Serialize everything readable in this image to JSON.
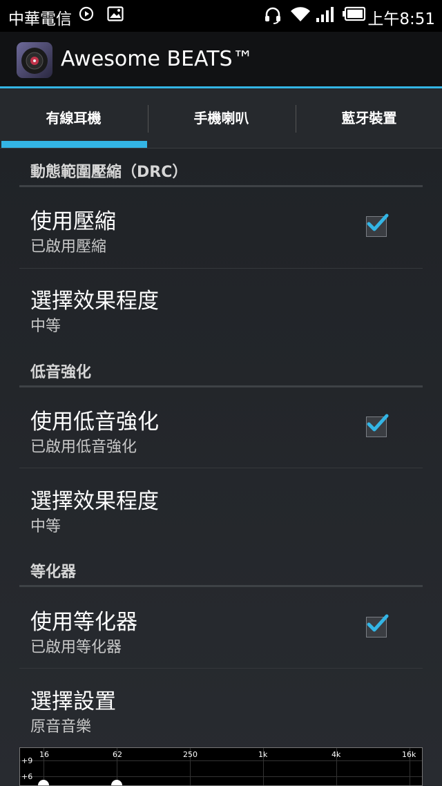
{
  "status_bar": {
    "carrier": "中華電信",
    "time": "上午8:51",
    "icons": [
      "play-circle-icon",
      "image-icon",
      "headset-icon",
      "wifi-icon",
      "signal-icon",
      "battery-icon"
    ]
  },
  "app": {
    "title": "Awesome BEATS™"
  },
  "tabs": [
    {
      "label": "有線耳機",
      "selected": true
    },
    {
      "label": "手機喇叭",
      "selected": false
    },
    {
      "label": "藍牙裝置",
      "selected": false
    }
  ],
  "sections": [
    {
      "header": "動態範圍壓縮（DRC）",
      "toggle": {
        "title": "使用壓縮",
        "summary": "已啟用壓縮",
        "checked": true
      },
      "option": {
        "title": "選擇效果程度",
        "value": "中等"
      }
    },
    {
      "header": "低音強化",
      "toggle": {
        "title": "使用低音強化",
        "summary": "已啟用低音強化",
        "checked": true
      },
      "option": {
        "title": "選擇效果程度",
        "value": "中等"
      }
    },
    {
      "header": "等化器",
      "toggle": {
        "title": "使用等化器",
        "summary": "已啟用等化器",
        "checked": true
      },
      "option": {
        "title": "選擇設置",
        "value": "原音音樂"
      }
    }
  ],
  "equalizer": {
    "freq_labels": [
      "16",
      "62",
      "250",
      "1k",
      "4k",
      "16k"
    ],
    "db_labels": [
      "+9",
      "+6"
    ]
  },
  "colors": {
    "accent": "#33b5e5",
    "background": "#1c1f23"
  }
}
